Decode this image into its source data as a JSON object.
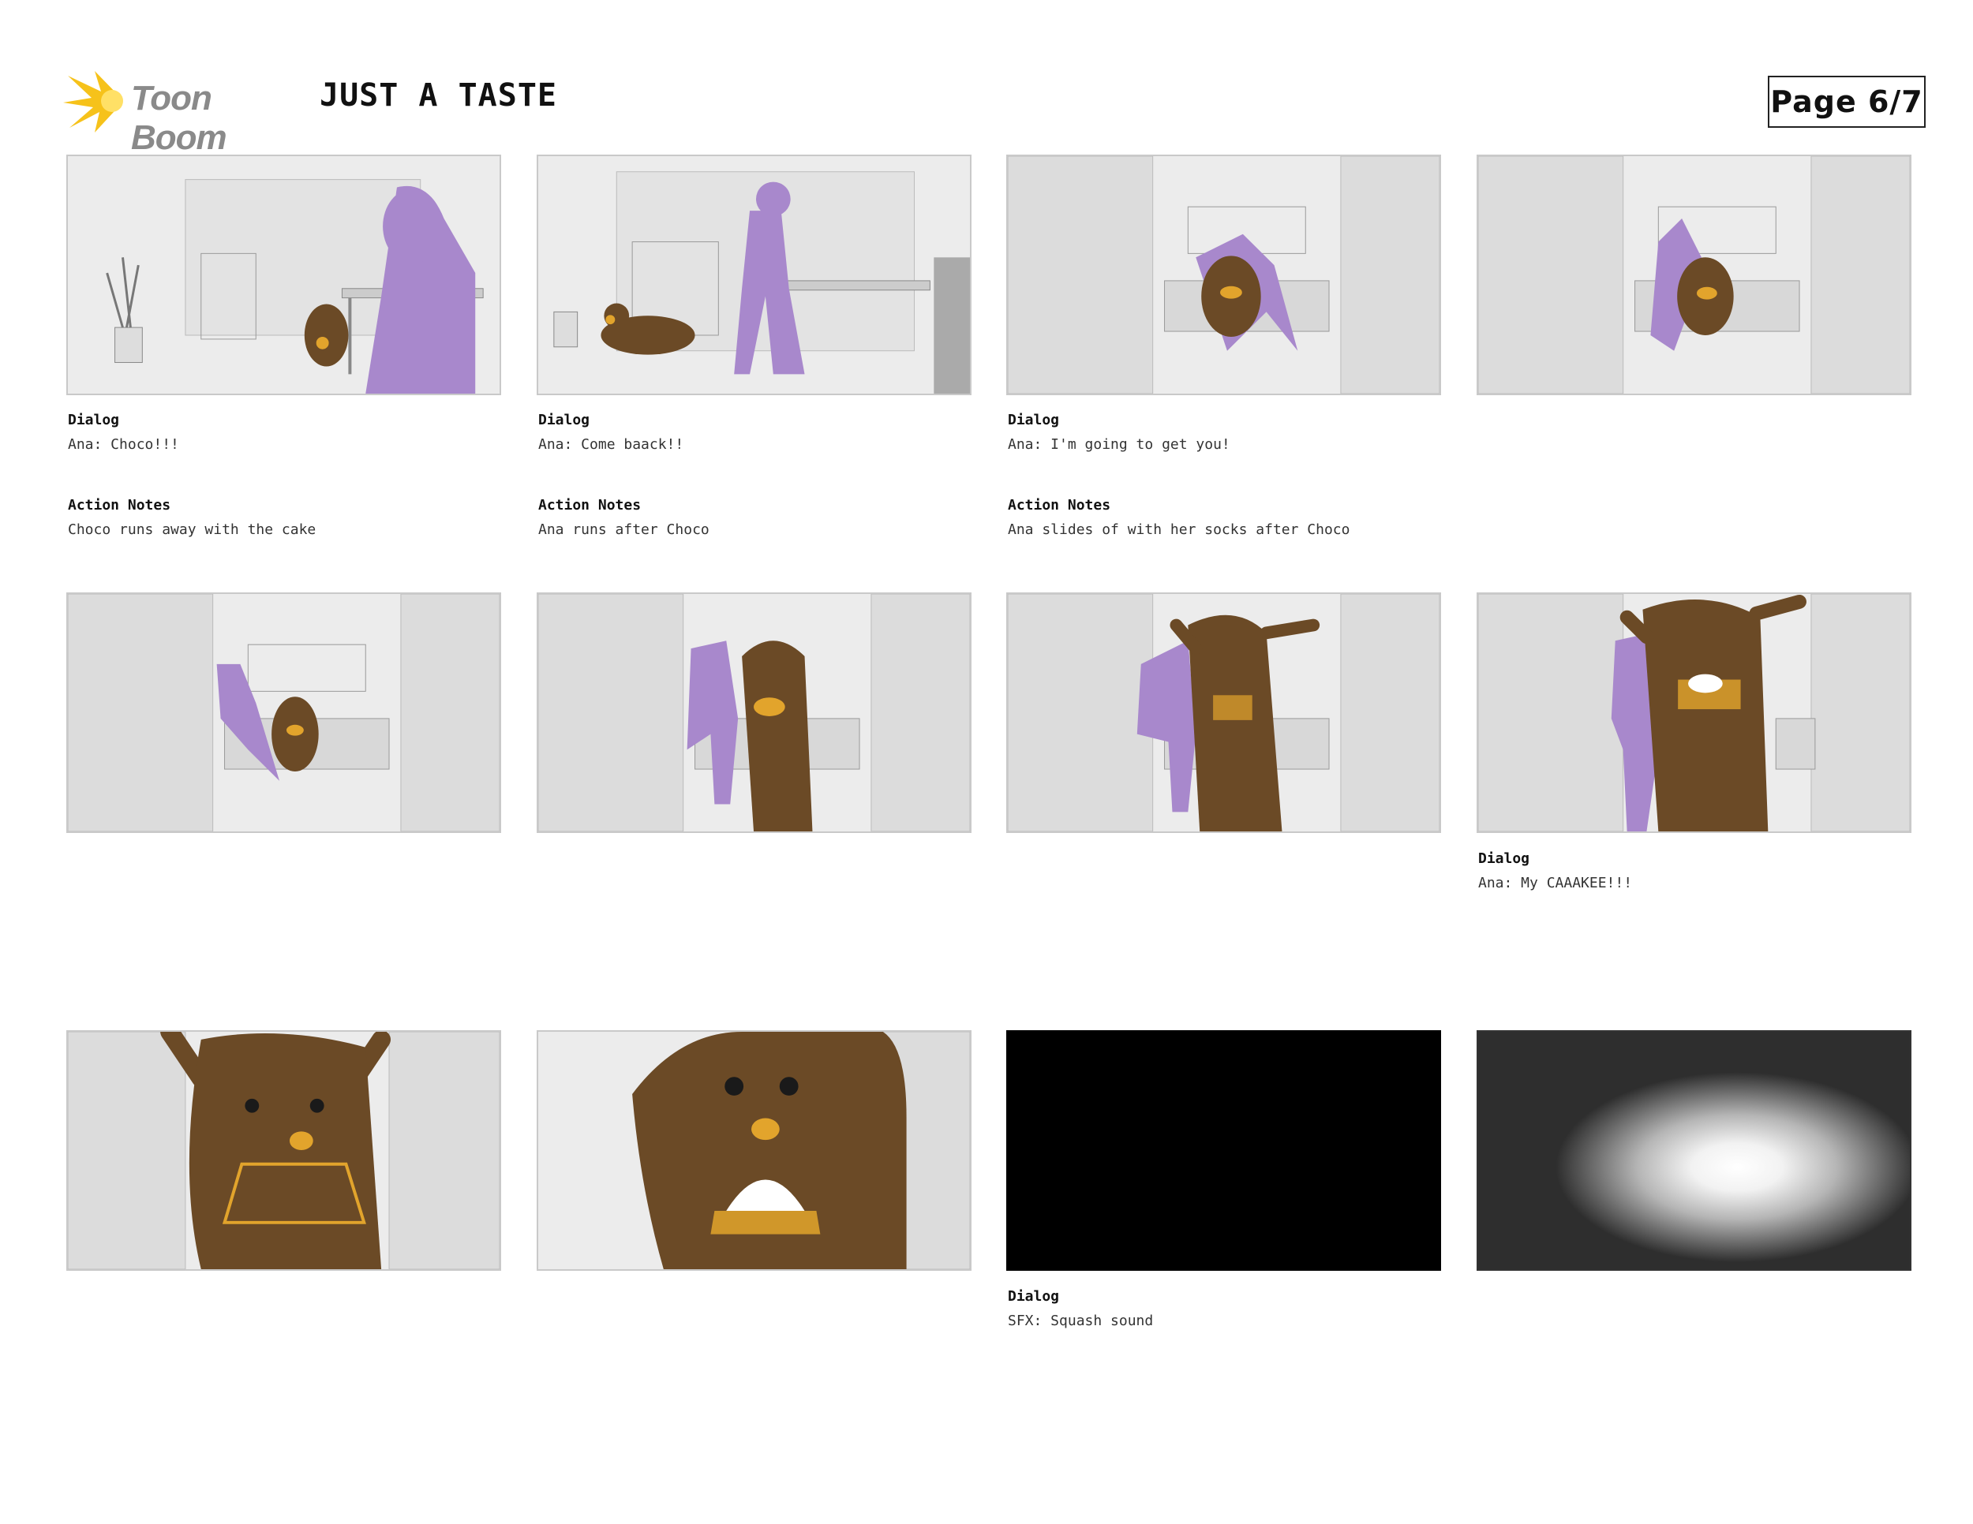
{
  "header": {
    "logo_text": "Toon Boom",
    "title": "JUST A TASTE",
    "page": "Page 6/7"
  },
  "colors": {
    "logo_burst": "#f6c21a",
    "logo_text": "#8a8a8a",
    "ana": "#a888cc",
    "choco": "#6b4a26",
    "cake": "#e2a42c",
    "set": "#d3d3d3"
  },
  "panels": [
    {
      "dialog_label": "Dialog",
      "dialog": "Ana: Choco!!!",
      "action_label": "Action Notes",
      "action": "Choco runs away with the cake"
    },
    {
      "dialog_label": "Dialog",
      "dialog": "Ana: Come baack!!",
      "action_label": "Action Notes",
      "action": "Ana runs after Choco"
    },
    {
      "dialog_label": "Dialog",
      "dialog": "Ana: I'm going to get you!",
      "action_label": "Action Notes",
      "action": "Ana slides of with her socks after Choco"
    },
    {},
    {},
    {},
    {},
    {
      "dialog_label": "Dialog",
      "dialog": "Ana: My CAAAKEE!!!"
    },
    {},
    {},
    {
      "dialog_label": "Dialog",
      "dialog": "SFX: Squash sound"
    },
    {}
  ]
}
